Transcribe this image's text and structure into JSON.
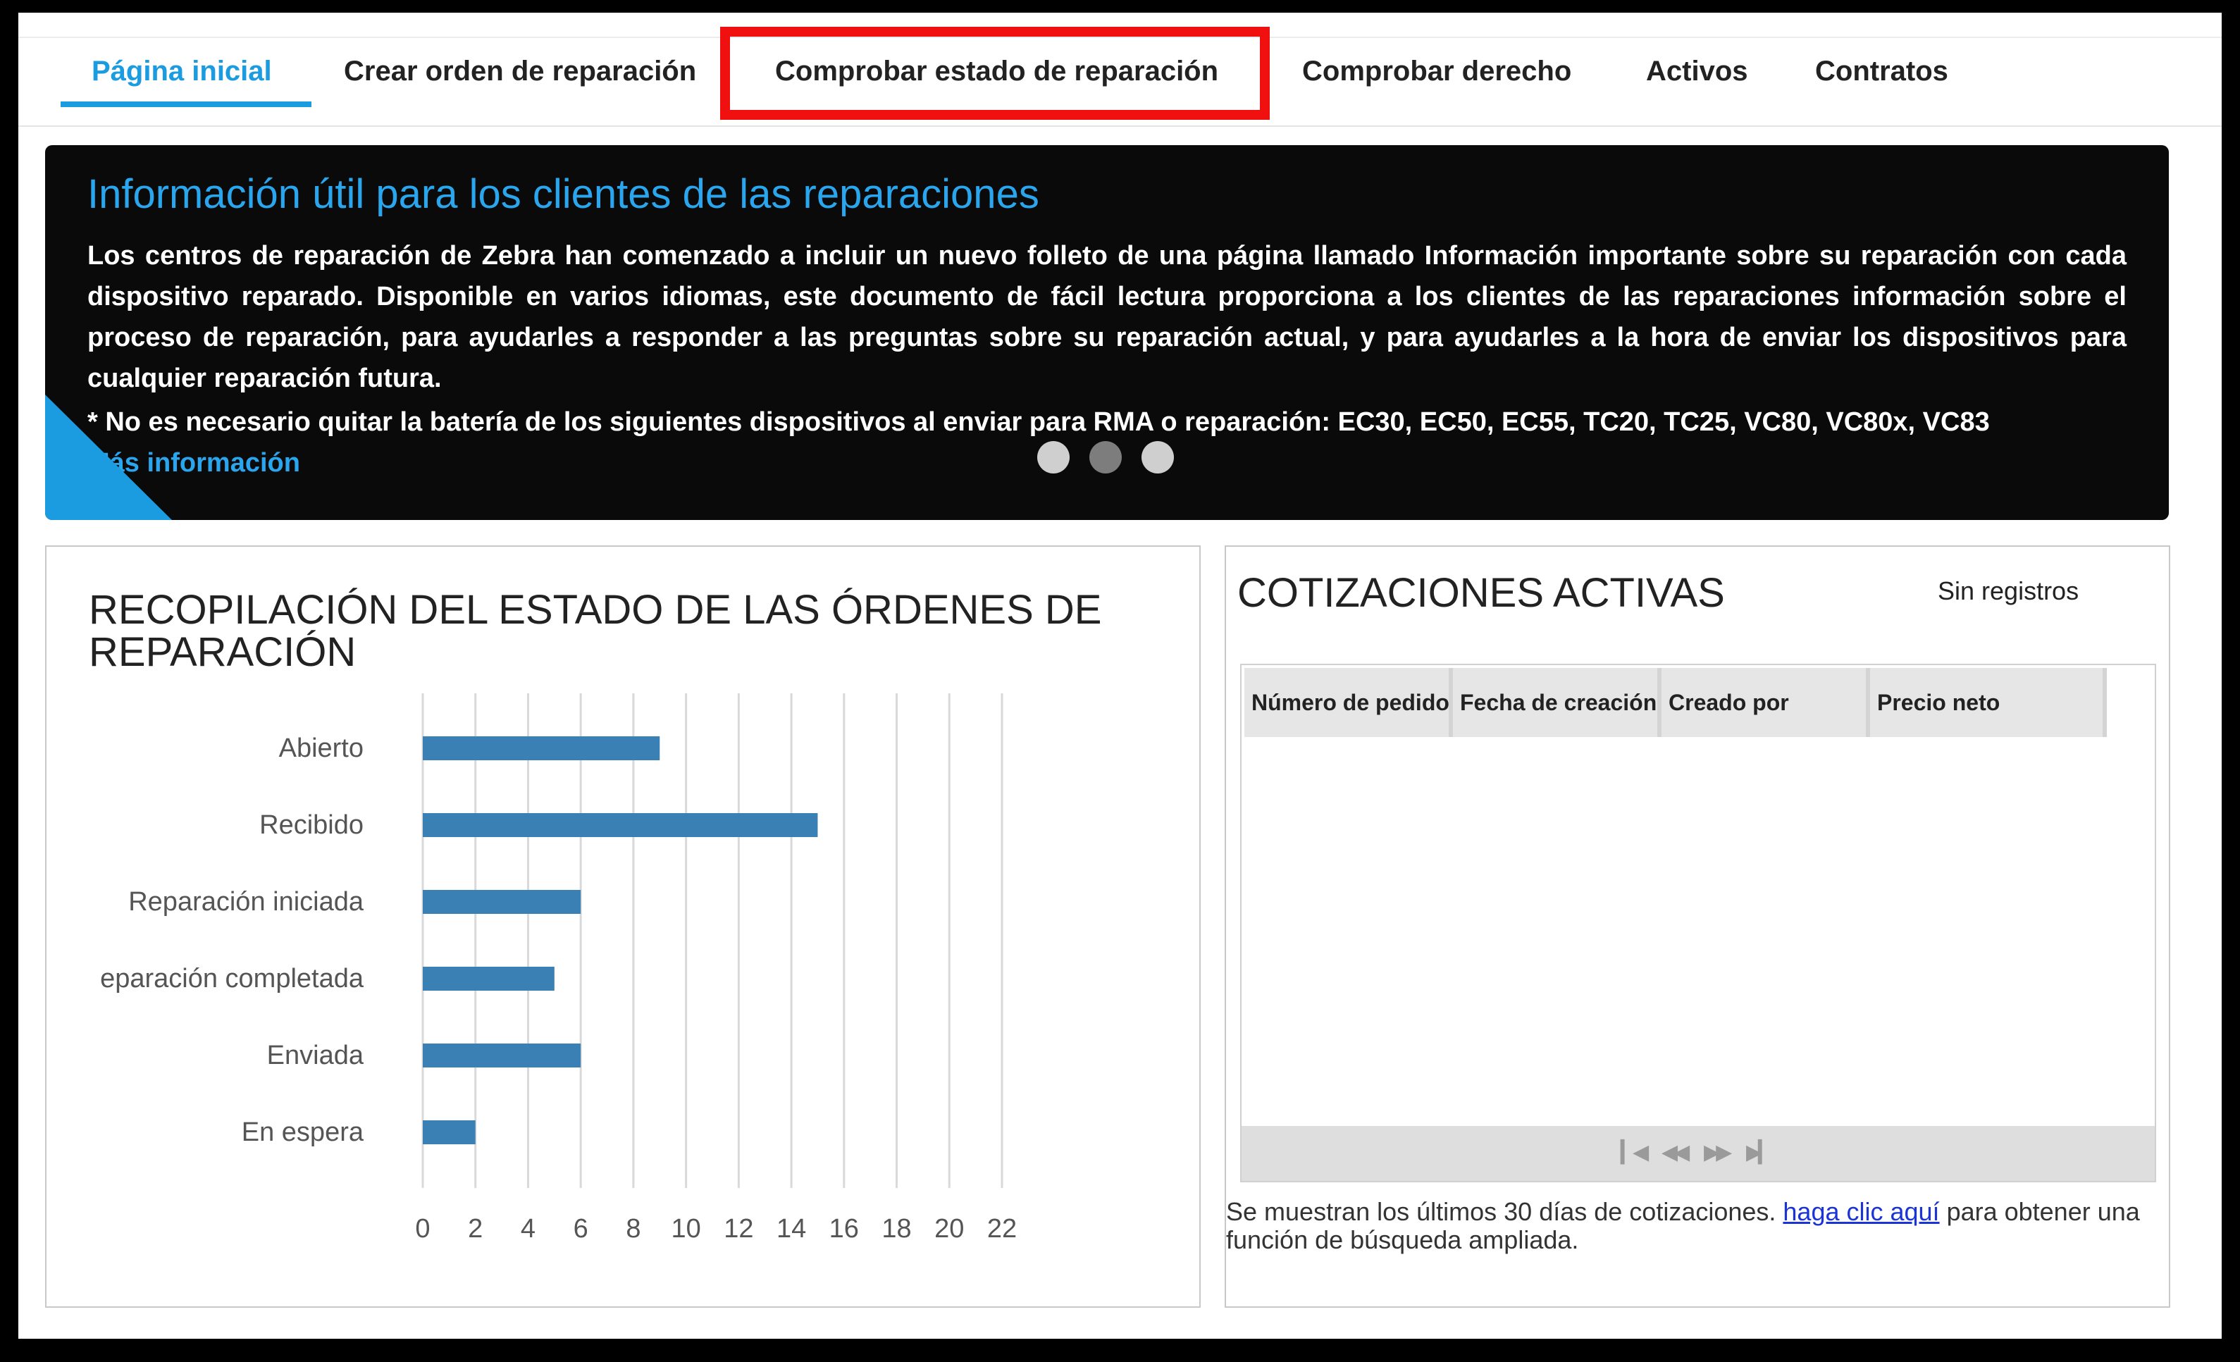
{
  "nav": {
    "tabs": [
      {
        "label": "Página inicial",
        "active": true
      },
      {
        "label": "Crear orden de reparación",
        "active": false
      },
      {
        "label": "Comprobar estado de reparación",
        "active": false
      },
      {
        "label": "Comprobar derecho",
        "active": false
      },
      {
        "label": "Activos",
        "active": false
      },
      {
        "label": "Contratos",
        "active": false
      }
    ],
    "highlight_color": "#f01010",
    "accent_color": "#1b9be0"
  },
  "banner": {
    "title": "Información útil para los clientes de las reparaciones",
    "body": "Los centros de reparación de Zebra han comenzado a incluir un nuevo folleto de una página llamado Información importante sobre su reparación con cada dispositivo reparado. Disponible en varios idiomas, este documento de fácil lectura proporciona a los clientes de las reparaciones información sobre el proceso de reparación, para ayudarles a responder a las preguntas sobre su reparación actual, y para ayudarles a la hora de enviar los dispositivos para cualquier reparación futura.",
    "note": "* No es necesario quitar la batería de los siguientes dispositivos al enviar para RMA o reparación: EC30, EC50, EC55, TC20, TC25, VC80, VC80x, VC83",
    "link": "Más información",
    "slides": 3,
    "active_slide": 2
  },
  "status_panel": {
    "title": "RECOPILACIÓN DEL ESTADO DE LAS ÓRDENES DE REPARACIÓN"
  },
  "chart_data": {
    "type": "bar",
    "orientation": "horizontal",
    "title": "RECOPILACIÓN DEL ESTADO DE LAS ÓRDENES DE REPARACIÓN",
    "categories": [
      "Abierto",
      "Recibido",
      "Reparación iniciada",
      "Reparación completada",
      "Enviada",
      "En espera"
    ],
    "category_labels_shown": [
      "Abierto",
      "Recibido",
      "Reparación iniciada",
      "eparación completada",
      "Enviada",
      "En espera"
    ],
    "values": [
      9,
      15,
      6,
      5,
      6,
      2
    ],
    "xlim": [
      0,
      22
    ],
    "xticks": [
      "0",
      "2",
      "4",
      "6",
      "8",
      "10",
      "12",
      "14",
      "16",
      "18",
      "20",
      "22"
    ],
    "grid": true,
    "bar_color": "#3a80b4",
    "xlabel": "",
    "ylabel": ""
  },
  "quotes_panel": {
    "title": "COTIZACIONES ACTIVAS",
    "count": "Sin registros",
    "columns": [
      "Número de pedido",
      "Fecha de creación",
      "Creado por",
      "Precio neto"
    ],
    "rows": [],
    "pager_icons": [
      "first-page-icon",
      "prev-page-icon",
      "next-page-icon",
      "last-page-icon"
    ],
    "note_before": "Se muestran los últimos 30 días de cotizaciones. ",
    "note_link": "haga clic aquí",
    "note_after": " para obtener una función de búsqueda ampliada."
  }
}
